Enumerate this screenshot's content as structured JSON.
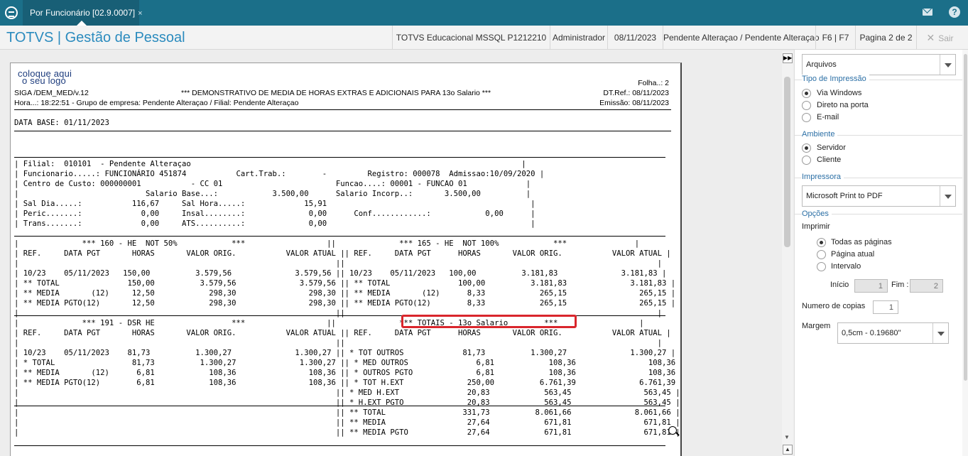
{
  "tab": {
    "label": "Por Funcionário [02.9.0007]",
    "close": "×"
  },
  "header": {
    "brand": "TOTVS | Gestão de Pessoal",
    "items": [
      "TOTVS Educacional MSSQL P1212210",
      "Administrador",
      "08/11/2023",
      "Pendente Alteraçao / Pendente Alteraçao",
      "F6 | F7",
      "Pagina 2 de 2"
    ],
    "exit_label": "Sair"
  },
  "report": {
    "logo_line1": "coloque aqui",
    "logo_line2": "o seu logo",
    "folha": "Folha..:    2",
    "siga": "SIGA /DEM_MED/v.12",
    "title": "*** DEMONSTRATIVO DE MEDIA DE HORAS EXTRAS E ADICIONAIS PARA 13o Salario    ***",
    "dtref": "DT.Ref.: 08/11/2023",
    "hora": "Hora...: 18:22:51 - Grupo de empresa: Pendente Alteraçao / Filial: Pendente Alteraçao",
    "emissao": "Emissão: 08/11/2023",
    "data_base": "DATA BASE: 01/11/2023",
    "body_lines": [
      "| Filial:  010101  - Pendente Alteraçao                                                                         |",
      "| Funcionario.....: FUNCIONÁRIO 451874           Cart.Trab.:        -         Registro: 000078  Admissao:10/09/2020 |",
      "| Centro de Custo: 000000001           - CC 01                         Funcao....: 00001 - FUNCAO 01             |",
      "|                            Salario Base...:            3.500,00      Salario Incorp..:       3.500,00          |",
      "| Sal Dia.....:           116,67     Sal Hora.....:             15,91                                             |",
      "| Peric.......:             0,00     Insal........:              0,00      Conf............:            0,00      |",
      "| Trans.......:             0,00     ATS..........:              0,00                                             |",
      "",
      "|              *** 160 - HE  NOT 50%            ***                  ||              *** 165 - HE  NOT 100%            ***               |",
      "| REF.     DATA PGT       HORAS       VALOR ORIG.           VALOR ATUAL || REF.     DATA PGT      HORAS       VALOR ORIG.           VALOR ATUAL |",
      "|                                                                      ||                                                                     |",
      "| 10/23    05/11/2023   150,00          3.579,56              3.579,56 || 10/23    05/11/2023   100,00          3.181,83              3.181,83 |",
      "| ** TOTAL               150,00          3.579,56              3.579,56 || ** TOTAL               100,00          3.181,83              3.181,83 |",
      "| ** MEDIA       (12)     12,50            298,30                298,30 || ** MEDIA       (12)      8,33            265,15                265,15 |",
      "| ** MEDIA PGTO(12)       12,50            298,30                298,30 || ** MEDIA PGTO(12)        8,33            265,15                265,15 |",
      "|                                                                      ||                                                                     |",
      "|              *** 191 - DSR HE                 ***                  ||              *** TOTAIS - 13o Salario        ***                  |",
      "| REF.     DATA PGT       HORAS       VALOR ORIG.           VALOR ATUAL || REF.     DATA PGT      HORAS       VALOR ORIG.           VALOR ATUAL |",
      "|                                                                      ||                                                                     |",
      "| 10/23    05/11/2023    81,73          1.300,27              1.300,27 || * TOT OUTROS             81,73          1.300,27              1.300,27 |",
      "| * TOTAL                 81,73          1.300,27              1.300,27 || * MED OUTROS               6,81            108,36                108,36 |",
      "| ** MEDIA       (12)      6,81            108,36                108,36 || * OUTROS PGTO              6,81            108,36                108,36 |",
      "| ** MEDIA PGTO(12)        6,81            108,36                108,36 || * TOT H.EXT              250,00          6.761,39              6.761,39 |",
      "|                                                                      || * MED H.EXT               20,83            563,45                563,45 |",
      "|                                                                      || * H.EXT PGTO              20,83            563,45                563,45 |",
      "|                                                                      || ** TOTAL                 331,73          8.061,66              8.061,66 |",
      "|                                                                      || ** MEDIA                  27,64            671,81                671,81 |",
      "|                                                                      || ** MEDIA PGTO             27,64            671,81                671,81 |"
    ]
  },
  "panel": {
    "arquivos": "Arquivos",
    "tipo_legend": "Tipo de Impressão",
    "tipo_options": [
      "Via Windows",
      "Direto na porta",
      "E-mail"
    ],
    "ambiente_legend": "Ambiente",
    "ambiente_options": [
      "Servidor",
      "Cliente"
    ],
    "impressora_legend": "Impressora",
    "impressora_value": "Microsoft Print to PDF",
    "opcoes_legend": "Opções",
    "imprimir_label": "Imprimir",
    "imprimir_options": [
      "Todas as páginas",
      "Página atual",
      "Intervalo"
    ],
    "inicio_label": "Início",
    "inicio_value": "1",
    "fim_label": "Fim :",
    "fim_value": "2",
    "copias_label": "Numero de copias",
    "copias_value": "1",
    "margem_label": "Margem",
    "margem_value": "0,5cm - 0.19680\""
  },
  "colors": {
    "titlebar": "#1b6f89",
    "brand": "#2b8bbe",
    "highlight": "#d9262c"
  }
}
